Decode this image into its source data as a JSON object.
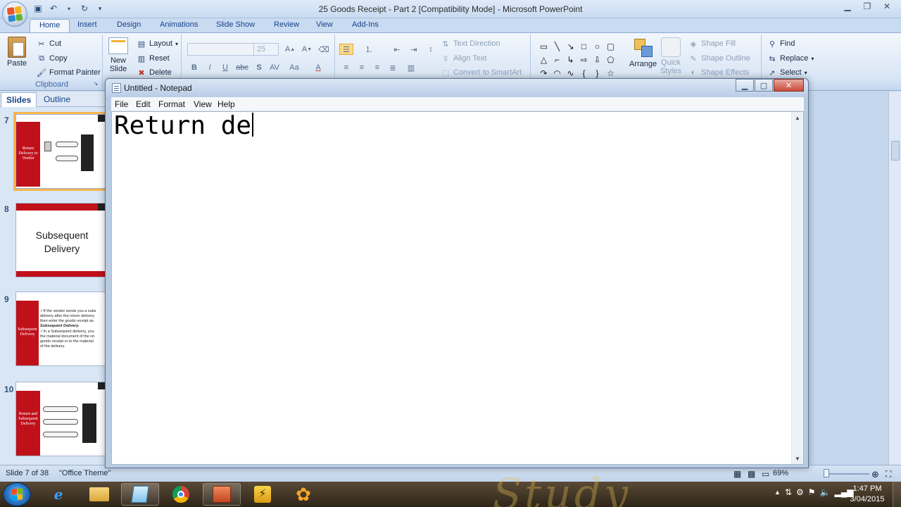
{
  "powerpoint": {
    "title": "25 Goods Receipt - Part 2 [Compatibility Mode] - Microsoft PowerPoint",
    "tabs": [
      "Home",
      "Insert",
      "Design",
      "Animations",
      "Slide Show",
      "Review",
      "View",
      "Add-Ins"
    ],
    "clipboard": {
      "paste": "Paste",
      "cut": "Cut",
      "copy": "Copy",
      "format_painter": "Format Painter",
      "group_label": "Clipboard"
    },
    "slides_group": {
      "new_slide_line1": "New",
      "new_slide_line2": "Slide",
      "layout": "Layout",
      "reset": "Reset",
      "delete": "Delete"
    },
    "font": {
      "size": "25"
    },
    "paragraph": {
      "text_direction": "Text Direction",
      "align_text": "Align Text",
      "convert_smartart": "Convert to SmartArt"
    },
    "drawing": {
      "arrange": "Arrange",
      "quick_styles_line1": "Quick",
      "quick_styles_line2": "Styles",
      "shape_fill": "Shape Fill",
      "shape_outline": "Shape Outline",
      "shape_effects": "Shape Effects"
    },
    "editing": {
      "find": "Find",
      "replace": "Replace",
      "select": "Select"
    },
    "panel_tabs": {
      "slides": "Slides",
      "outline": "Outline"
    },
    "slides": [
      {
        "number": "7",
        "text": "Return Delivery to Vendor"
      },
      {
        "number": "8",
        "text_line1": "Subsequent",
        "text_line2": "Delivery"
      },
      {
        "number": "9",
        "text": "Subsequent Delivery",
        "bullets": [
          "✓If the vendor sends you a subs",
          "delivery after the return delivery",
          "then enter the goods receipt as",
          "Subsequent Delivery.",
          "✓In a Subsequent delivery, you",
          "the material document of the ori",
          "goods receipt or to the material",
          "of the delivery."
        ]
      },
      {
        "number": "10",
        "text": "Return and Subsequent Delivery"
      }
    ],
    "status": {
      "slide_info": "Slide 7 of 38",
      "theme": "\"Office Theme\"",
      "zoom": "69%"
    }
  },
  "notepad": {
    "title": "Untitled - Notepad",
    "menus": [
      "File",
      "Edit",
      "Format",
      "View",
      "Help"
    ],
    "content": "Return de"
  },
  "taskbar": {
    "time": "1:47 PM",
    "date": "3/04/2015"
  }
}
